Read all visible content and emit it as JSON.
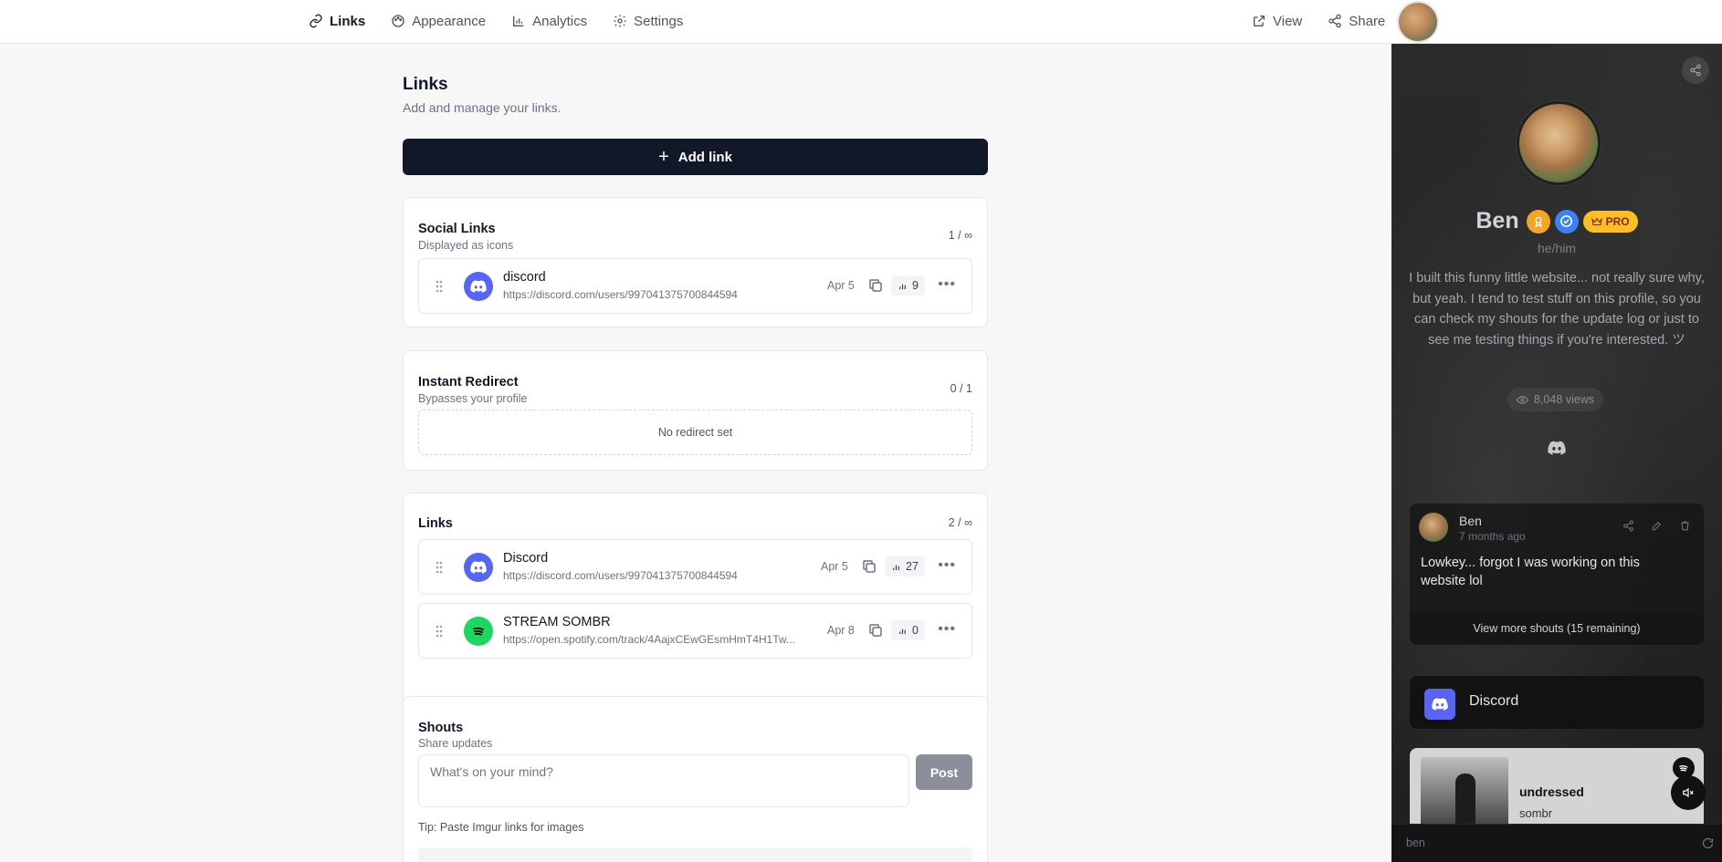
{
  "nav": {
    "tabs": [
      {
        "label": "Links",
        "icon": "link-icon"
      },
      {
        "label": "Appearance",
        "icon": "palette-icon"
      },
      {
        "label": "Analytics",
        "icon": "bar-chart-icon"
      },
      {
        "label": "Settings",
        "icon": "gear-icon"
      }
    ],
    "active_tab": "Links",
    "view_label": "View",
    "share_label": "Share"
  },
  "header": {
    "title": "Links",
    "subtitle": "Add and manage your links.",
    "add_button_label": "Add link"
  },
  "social_links": {
    "title": "Social Links",
    "subtitle": "Displayed as icons",
    "count": "1 / ∞",
    "items": [
      {
        "name": "discord",
        "url": "https://discord.com/users/997041375700844594",
        "date": "Apr 5",
        "clicks": "9",
        "icon": "discord-icon"
      }
    ]
  },
  "instant_redirect": {
    "title": "Instant Redirect",
    "subtitle": "Bypasses your profile",
    "count": "0 / 1",
    "empty_text": "No redirect set"
  },
  "links": {
    "title": "Links",
    "count": "2 / ∞",
    "items": [
      {
        "name": "Discord",
        "url": "https://discord.com/users/997041375700844594",
        "date": "Apr 5",
        "clicks": "27",
        "icon": "discord-icon"
      },
      {
        "name": "STREAM SOMBR",
        "url": "https://open.spotify.com/track/4AajxCEwGEsmHmT4H1Tw...",
        "date": "Apr 8",
        "clicks": "0",
        "icon": "spotify-icon"
      }
    ]
  },
  "shouts": {
    "title": "Shouts",
    "subtitle": "Share updates",
    "placeholder": "What's on your mind?",
    "post_label": "Post",
    "tip": "Tip: Paste Imgur links for images"
  },
  "preview": {
    "name": "Ben",
    "pro_label": "PRO",
    "pronouns": "he/him",
    "bio": "I built this funny little website... not really sure why, but yeah. I tend to test stuff on this profile, so you can check my shouts for the update log or just to see me testing things if you're interested. ツ",
    "views": "8,048 views",
    "shout": {
      "author": "Ben",
      "time": "7 months ago",
      "text": "Lowkey... forgot I was working on this website lol"
    },
    "more_shouts": "View more shouts (15 remaining)",
    "discord_link_label": "Discord",
    "spotify": {
      "track": "undressed",
      "artist": "sombr"
    },
    "url": "ben"
  },
  "colors": {
    "accent_dark": "#111827",
    "discord": "#5865f2",
    "spotify": "#1ed760",
    "pro_badge": "#fbbf24",
    "verified_badge": "#3b82f6",
    "gold_badge": "#f5a524"
  }
}
